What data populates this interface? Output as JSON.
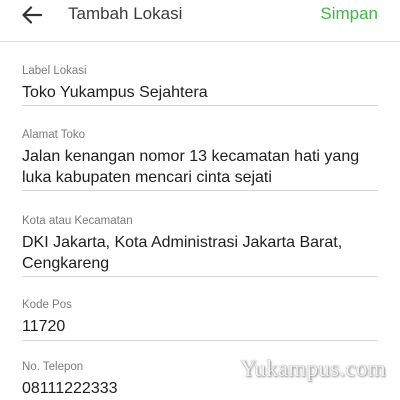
{
  "header": {
    "title": "Tambah Lokasi",
    "save_label": "Simpan",
    "back_icon": "arrow-left-icon"
  },
  "colors": {
    "accent": "#42b549",
    "label": "#7a7a7a",
    "value": "#1e1e1e"
  },
  "form": {
    "fields": [
      {
        "label": "Label Lokasi",
        "value": "Toko Yukampus Sejahtera"
      },
      {
        "label": "Alamat Toko",
        "value": "Jalan kenangan nomor 13 kecamatan hati yang luka kabupaten mencari cinta sejati"
      },
      {
        "label": "Kota atau Kecamatan",
        "value": "DKI Jakarta, Kota Administrasi Jakarta Barat, Cengkareng"
      },
      {
        "label": "Kode Pos",
        "value": "11720"
      },
      {
        "label": "No. Telepon",
        "value": "08111222333"
      }
    ]
  },
  "watermark": "Yukampus.com"
}
